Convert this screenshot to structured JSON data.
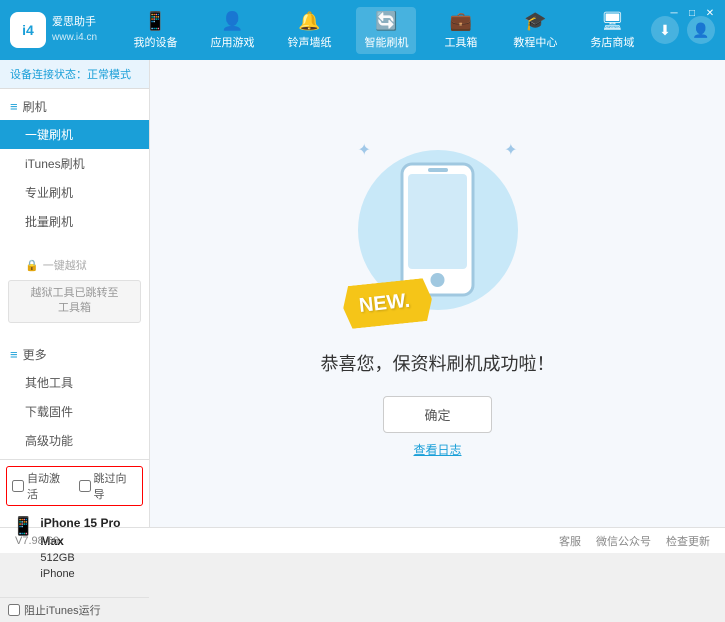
{
  "app": {
    "logo_text_line1": "爱思助手",
    "logo_text_line2": "www.i4.cn",
    "logo_abbr": "i4"
  },
  "nav": {
    "items": [
      {
        "id": "my-device",
        "icon": "📱",
        "label": "我的设备"
      },
      {
        "id": "apps-games",
        "icon": "👤",
        "label": "应用游戏"
      },
      {
        "id": "ringtone",
        "icon": "🔔",
        "label": "铃声墙纸"
      },
      {
        "id": "smart-flash",
        "icon": "🔄",
        "label": "智能刷机",
        "active": true
      },
      {
        "id": "toolbox",
        "icon": "💼",
        "label": "工具箱"
      },
      {
        "id": "tutorial",
        "icon": "🎓",
        "label": "教程中心"
      },
      {
        "id": "service",
        "icon": "🖥",
        "label": "务店商域"
      }
    ]
  },
  "sidebar": {
    "status_prefix": "设备连接状态：",
    "status_value": "正常模式",
    "groups": [
      {
        "id": "flash",
        "icon": "🔧",
        "label": "刷机",
        "items": [
          {
            "id": "one-click-flash",
            "label": "一键刷机",
            "active": true
          },
          {
            "id": "itunes-flash",
            "label": "iTunes刷机"
          },
          {
            "id": "pro-flash",
            "label": "专业刷机"
          },
          {
            "id": "batch-flash",
            "label": "批量刷机"
          }
        ]
      },
      {
        "id": "one-click-jailbreak",
        "icon": "🔒",
        "label": "一键越狱",
        "disabled": true,
        "disabled_msg": "越狱工具已跳转至\n工具箱"
      }
    ],
    "more_group": {
      "label": "更多",
      "items": [
        {
          "id": "other-tools",
          "label": "其他工具"
        },
        {
          "id": "download-firmware",
          "label": "下载固件"
        },
        {
          "id": "advanced",
          "label": "高级功能"
        }
      ]
    },
    "checkboxes": [
      {
        "id": "auto-activate",
        "label": "自动激活",
        "checked": false
      },
      {
        "id": "sync-import",
        "label": "跳过向导",
        "checked": false
      }
    ],
    "device": {
      "name": "iPhone 15 Pro Max",
      "storage": "512GB",
      "type": "iPhone"
    },
    "stop_itunes": "阻止iTunes运行",
    "stop_itunes_checked": false
  },
  "main": {
    "new_badge": "NEW.",
    "success_message": "恭喜您，保资料刷机成功啦！",
    "confirm_button": "确定",
    "log_button": "查看日志"
  },
  "footer": {
    "version": "V7.98.66",
    "links": [
      "客服",
      "微信公众号",
      "检查更新"
    ]
  }
}
